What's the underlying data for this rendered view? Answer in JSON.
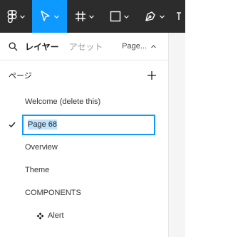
{
  "toolbar": {
    "tools": [
      {
        "name": "main-menu",
        "icon": "figma-logo-icon",
        "active": false
      },
      {
        "name": "move",
        "icon": "cursor-arrow-icon",
        "active": true
      },
      {
        "name": "frame",
        "icon": "frame-hash-icon",
        "active": false
      },
      {
        "name": "shape",
        "icon": "rectangle-icon",
        "active": false
      },
      {
        "name": "pen",
        "icon": "pen-tool-icon",
        "active": false
      }
    ],
    "colors": {
      "background": "#2c2c2c",
      "active": "#0d99ff",
      "icon": "#ffffff"
    }
  },
  "panel": {
    "tabs": {
      "layers": "レイヤー",
      "assets": "アセット"
    },
    "current_page_short": "Page..."
  },
  "pages": {
    "title": "ページ",
    "items": [
      {
        "label": "Welcome (delete this)",
        "current": false
      },
      {
        "label": "Page 68",
        "current": true,
        "editing": true
      },
      {
        "label": "Overview",
        "current": false
      },
      {
        "label": "Theme",
        "current": false
      },
      {
        "label": "COMPONENTS",
        "current": false
      },
      {
        "label": "Alert",
        "current": false,
        "icon": "component-icon"
      }
    ]
  },
  "colors": {
    "accent": "#0d99ff",
    "selection": "#bde3ff"
  }
}
